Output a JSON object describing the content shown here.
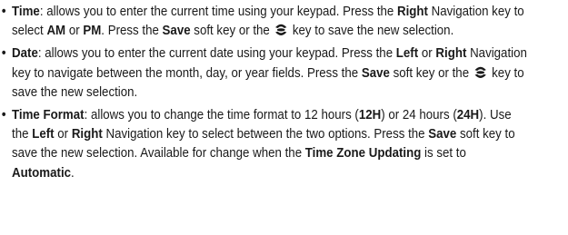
{
  "bullet_glyph": "•",
  "items": [
    {
      "term": "Time",
      "parts": [
        {
          "t": ": allows you to enter the current time using your keypad. Press the "
        },
        {
          "b": "Right"
        },
        {
          "t": " Navigation key to select "
        },
        {
          "b": "AM"
        },
        {
          "t": " or "
        },
        {
          "b": "PM"
        },
        {
          "t": ". Press the "
        },
        {
          "b": "Save"
        },
        {
          "t": " soft key or the "
        },
        {
          "icon": "ok-key-icon"
        },
        {
          "t": " key to save the new selection."
        }
      ]
    },
    {
      "term": "Date",
      "parts": [
        {
          "t": ": allows you to enter the current date using your keypad. Press the "
        },
        {
          "b": "Left"
        },
        {
          "t": " or "
        },
        {
          "b": "Right"
        },
        {
          "t": " Navigation key to navigate between the month, day, or year fields. Press the "
        },
        {
          "b": "Save"
        },
        {
          "t": " soft key or the "
        },
        {
          "icon": "ok-key-icon"
        },
        {
          "t": " key to save the new selection."
        }
      ]
    },
    {
      "term": "Time Format",
      "parts": [
        {
          "t": ": allows you to change the time format to 12 hours ("
        },
        {
          "b": "12H"
        },
        {
          "t": ") or 24 hours ("
        },
        {
          "b": "24H"
        },
        {
          "t": "). Use the "
        },
        {
          "b": "Left"
        },
        {
          "t": " or "
        },
        {
          "b": "Right"
        },
        {
          "t": " Navigation key to select between the two options. Press the "
        },
        {
          "b": "Save"
        },
        {
          "t": " soft key to save the new selection. Available for change when the "
        },
        {
          "b": "Time Zone Updating"
        },
        {
          "t": " is set to "
        },
        {
          "b": "Automatic"
        },
        {
          "t": "."
        }
      ]
    }
  ]
}
